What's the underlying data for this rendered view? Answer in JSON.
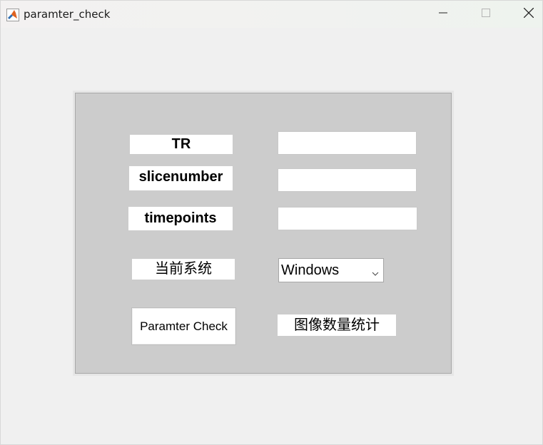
{
  "window": {
    "title": "paramter_check"
  },
  "labels": {
    "tr": "TR",
    "slicenumber": "slicenumber",
    "timepoints": "timepoints",
    "current_system": "当前系统",
    "image_count": "图像数量统计"
  },
  "inputs": {
    "tr_value": "",
    "slicenumber_value": "",
    "timepoints_value": ""
  },
  "system_select": {
    "selected": "Windows"
  },
  "buttons": {
    "paramter_check": "Paramter Check"
  },
  "icons": {
    "app": "matlab-icon",
    "minimize": "minimize-icon",
    "maximize": "maximize-icon",
    "close": "close-icon",
    "dropdown": "chevron-down-icon"
  }
}
